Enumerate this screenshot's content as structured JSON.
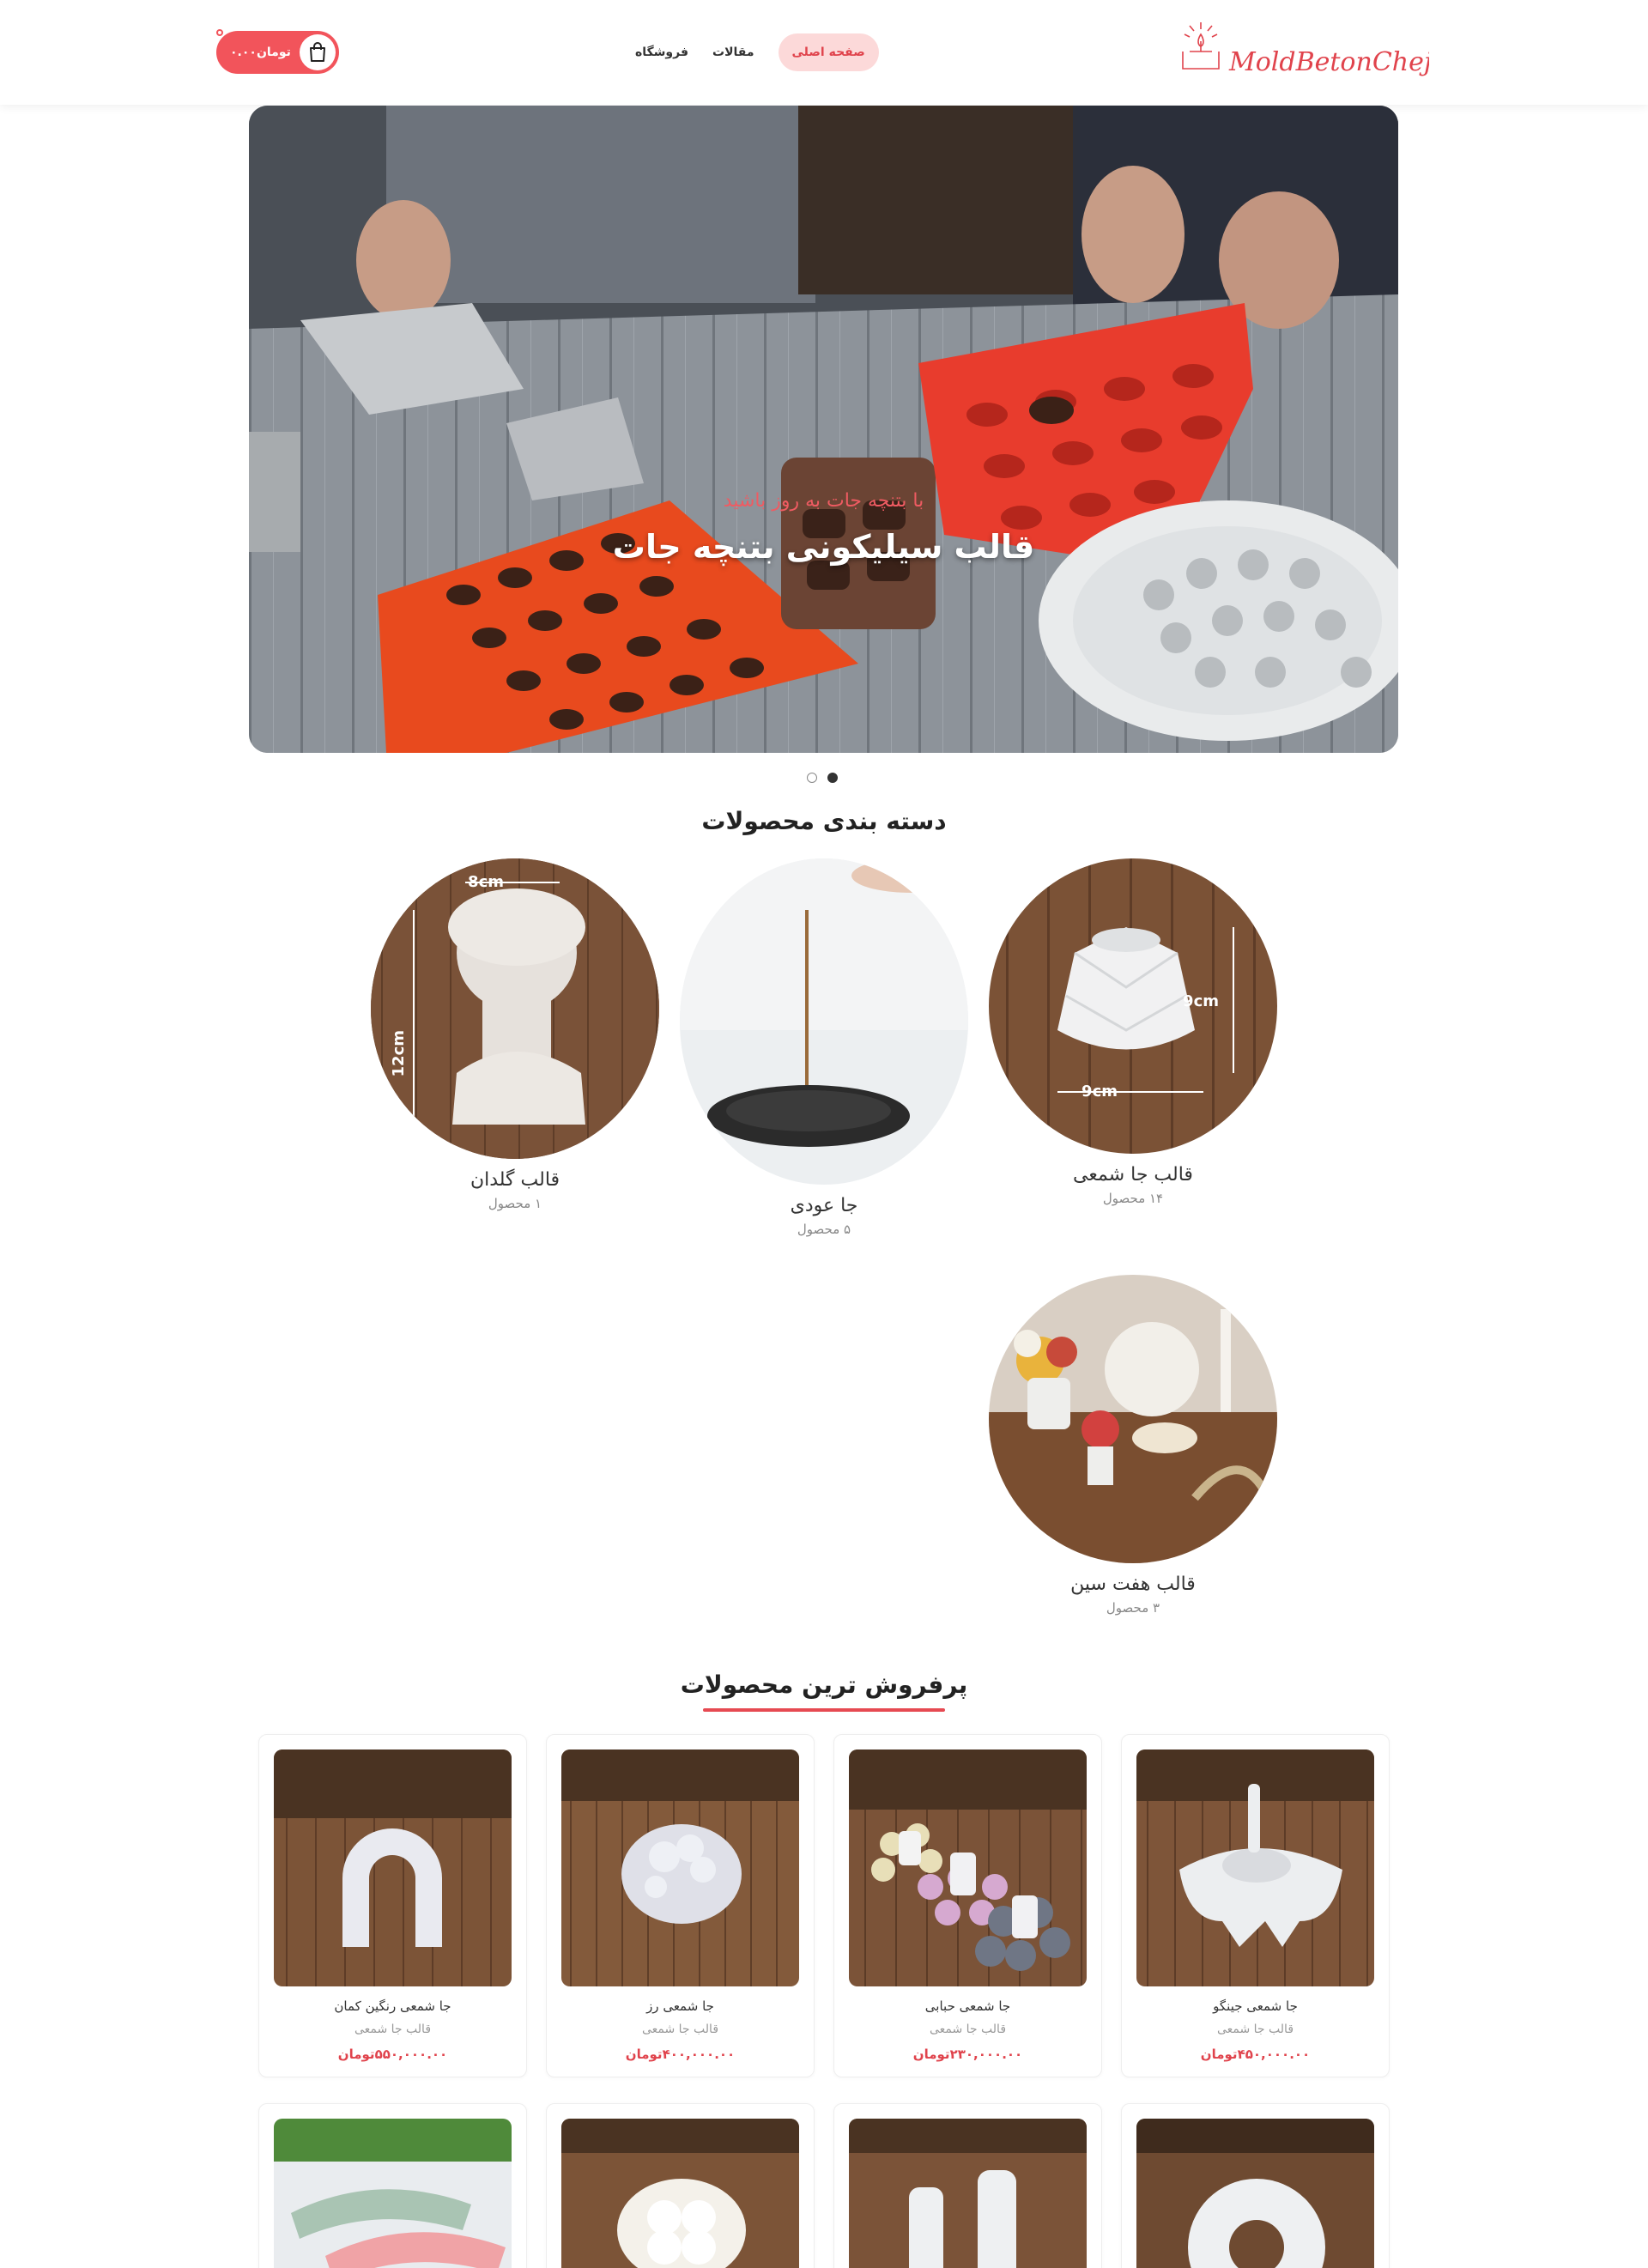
{
  "header": {
    "cart_total": "تومان۰.۰۰",
    "nav": [
      "صفحه اصلی",
      "مقالات",
      "فروشگاه"
    ],
    "logo_text": "MoldBetonChejat",
    "accent_color": "#f2545b"
  },
  "hero": {
    "subtitle": "با بتنچه جات به روز باشید",
    "title": "قالب سیلیکونی بتنچه جات",
    "slides": 2,
    "active_slide": 2
  },
  "categories": {
    "title": "دسته بندی محصولات",
    "items": [
      {
        "name": "قالب گلدان",
        "count": "۱ محصول",
        "labels": [
          "8cm",
          "12cm"
        ]
      },
      {
        "name": "جا عودی",
        "count": "۵ محصول"
      },
      {
        "name": "قالب جا شمعی",
        "count": "۱۴ محصول",
        "labels": [
          "9cm",
          "9cm"
        ]
      },
      {
        "name": "قالب هفت سین",
        "count": "۳ محصول"
      }
    ]
  },
  "bestsellers": {
    "title": "پرفروش ترین محصولات",
    "products": [
      {
        "name": "جا شمعی رنگین کمان",
        "category": "قالب جا شمعی",
        "price": "۵۵۰,۰۰۰.۰۰تومان"
      },
      {
        "name": "جا شمعی رز",
        "category": "قالب جا شمعی",
        "price": "۴۰۰,۰۰۰.۰۰تومان"
      },
      {
        "name": "جا شمعی حبابی",
        "category": "قالب جا شمعی",
        "price": "۲۳۰,۰۰۰.۰۰تومان"
      },
      {
        "name": "جا شمعی جینگو",
        "category": "قالب جا شمعی",
        "price": "۴۵۰,۰۰۰.۰۰تومان"
      }
    ]
  }
}
